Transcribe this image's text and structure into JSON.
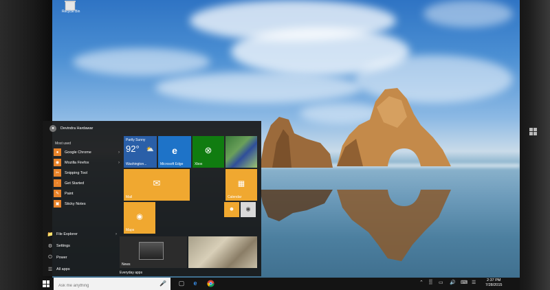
{
  "desktop": {
    "recycle_bin_label": "Recycle Bin"
  },
  "start_menu": {
    "user_name": "Devindra Hardawar",
    "most_used_label": "Most used",
    "apps": [
      {
        "label": "Google Chrome",
        "icon": "chrome-icon",
        "has_submenu": true
      },
      {
        "label": "Mozilla Firefox",
        "icon": "firefox-icon",
        "has_submenu": true
      },
      {
        "label": "Snipping Tool",
        "icon": "scissors-icon",
        "has_submenu": false
      },
      {
        "label": "Get Started",
        "icon": "lightbulb-icon",
        "has_submenu": false
      },
      {
        "label": "Paint",
        "icon": "paint-icon",
        "has_submenu": false
      },
      {
        "label": "Sticky Notes",
        "icon": "note-icon",
        "has_submenu": false
      }
    ],
    "system_items": [
      {
        "label": "File Explorer",
        "icon": "folder-icon",
        "has_submenu": true
      },
      {
        "label": "Settings",
        "icon": "gear-icon"
      },
      {
        "label": "Power",
        "icon": "power-icon"
      },
      {
        "label": "All apps",
        "icon": "list-icon"
      }
    ],
    "tiles": {
      "weather": {
        "condition": "Partly Sunny",
        "temp": "92°",
        "location": "Washington..."
      },
      "edge": {
        "label": "Microsoft Edge"
      },
      "xbox": {
        "label": "Xbox"
      },
      "mail": {
        "label": "Mail"
      },
      "calendar": {
        "label": "Calendar"
      },
      "maps": {
        "label": "Maps"
      },
      "news": {
        "label": "News"
      },
      "everyday": {
        "label": "Everyday apps"
      }
    }
  },
  "taskbar": {
    "search_placeholder": "Ask me anything",
    "time": "2:37 PM",
    "date": "7/28/2015"
  },
  "colors": {
    "accent": "#f0a830",
    "edge_blue": "#1e73c8",
    "xbox_green": "#107c10",
    "taskbar": "#141414"
  }
}
